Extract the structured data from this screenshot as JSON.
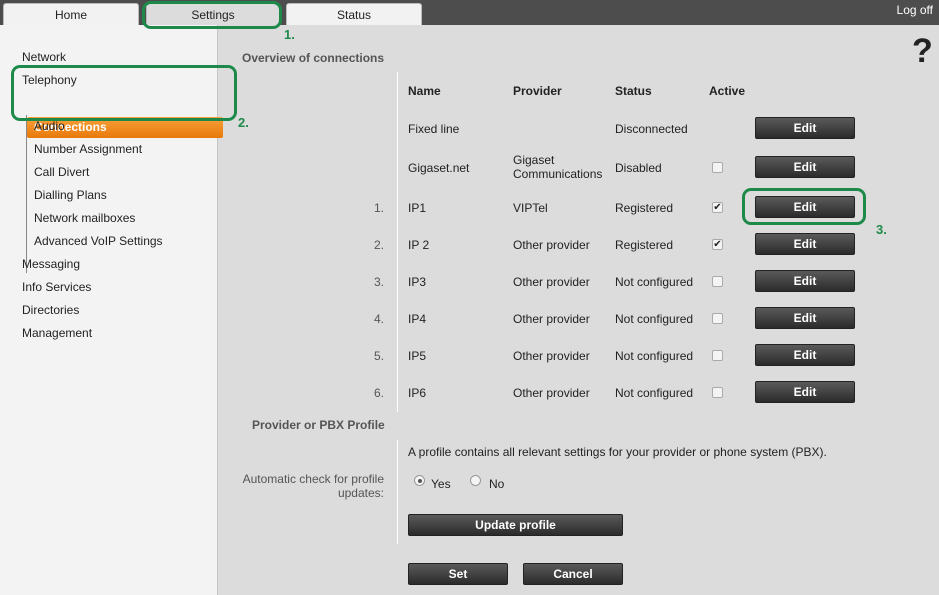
{
  "tabs": {
    "home": "Home",
    "settings": "Settings",
    "status": "Status"
  },
  "logoff": "Log off",
  "help_icon": "?",
  "sidebar": {
    "network": "Network",
    "telephony": "Telephony",
    "sub": [
      "Connections",
      "Audio",
      "Number Assignment",
      "Call Divert",
      "Dialling Plans",
      "Network mailboxes",
      "Advanced VoIP Settings"
    ],
    "messaging": "Messaging",
    "info_services": "Info Services",
    "directories": "Directories",
    "management": "Management"
  },
  "overview": {
    "title": "Overview of connections",
    "headers": [
      "Name",
      "Provider",
      "Status",
      "Active"
    ],
    "rows": [
      {
        "num": "",
        "name": "Fixed line",
        "provider": "",
        "status": "Disconnected",
        "active": null
      },
      {
        "num": "",
        "name": "Gigaset.net",
        "provider": "Gigaset Communications",
        "status": "Disabled",
        "active": false
      },
      {
        "num": "1.",
        "name": "IP1",
        "provider": "VIPTel",
        "status": "Registered",
        "active": true
      },
      {
        "num": "2.",
        "name": "IP 2",
        "provider": "Other provider",
        "status": "Registered",
        "active": true
      },
      {
        "num": "3.",
        "name": "IP3",
        "provider": "Other provider",
        "status": "Not configured",
        "active": false
      },
      {
        "num": "4.",
        "name": "IP4",
        "provider": "Other provider",
        "status": "Not configured",
        "active": false
      },
      {
        "num": "5.",
        "name": "IP5",
        "provider": "Other provider",
        "status": "Not configured",
        "active": false
      },
      {
        "num": "6.",
        "name": "IP6",
        "provider": "Other provider",
        "status": "Not configured",
        "active": false
      }
    ],
    "edit_label": "Edit"
  },
  "profile": {
    "title": "Provider or PBX Profile",
    "description": "A profile contains all relevant settings for your provider or phone system (PBX).",
    "auto_check_label": "Automatic check for profile updates:",
    "yes": "Yes",
    "no": "No",
    "selected": "Yes",
    "update_button": "Update profile"
  },
  "set_button": "Set",
  "cancel_button": "Cancel",
  "annotations": {
    "a1": "1.",
    "a2": "2.",
    "a3": "3.",
    "color": "#1e8a4a"
  },
  "colors": {
    "accent": "#f08a1c",
    "topbar": "#4d4d4d"
  }
}
